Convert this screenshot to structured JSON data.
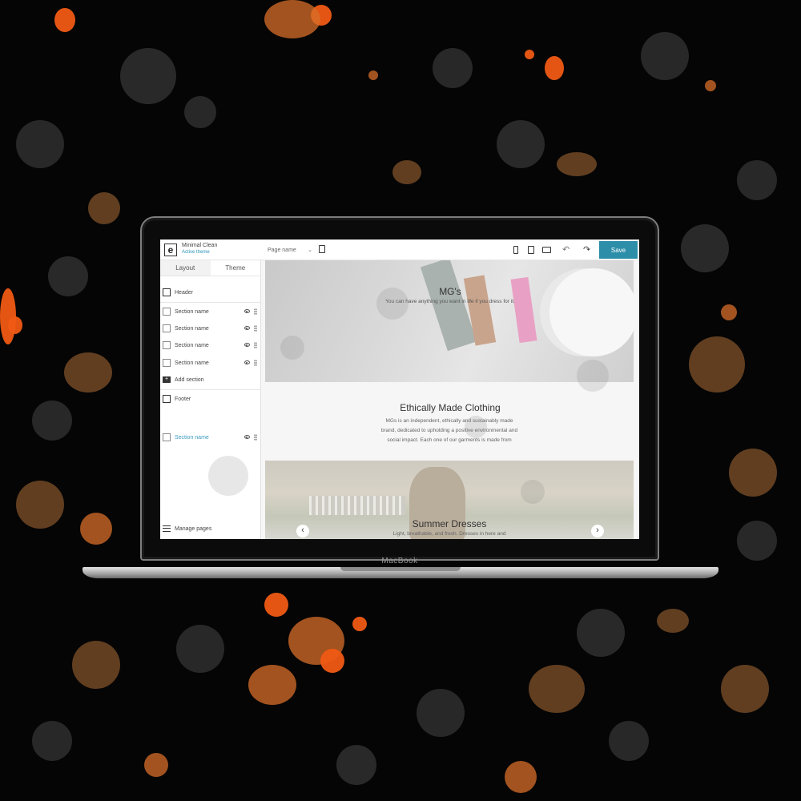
{
  "colors": {
    "accent": "#2d8ea9",
    "active_theme_text": "#2b94b8",
    "selected_section_text": "#3c9ac0",
    "background": "#050505",
    "splatter_orange": "#f05a14"
  },
  "device": {
    "brand_label": "MacBook"
  },
  "topbar": {
    "theme_name": "Minimal Clean",
    "theme_status": "Active theme",
    "page_select_value": "Page name",
    "save_label": "Save",
    "icons": [
      "document-icon",
      "mobile-icon",
      "tablet-icon",
      "desktop-icon",
      "undo-icon",
      "redo-icon"
    ]
  },
  "sidebar": {
    "tabs": [
      {
        "label": "Layout",
        "active": true
      },
      {
        "label": "Theme",
        "active": false
      }
    ],
    "header_label": "Header",
    "sections": [
      {
        "label": "Section name"
      },
      {
        "label": "Section name"
      },
      {
        "label": "Section name"
      },
      {
        "label": "Section name"
      }
    ],
    "add_section_label": "Add section",
    "footer_label": "Footer",
    "extra_section_label": "Section name",
    "manage_pages_label": "Manage pages"
  },
  "preview": {
    "hero": {
      "title": "MG's",
      "subtitle": "You can have anything you want in life if you dress for it."
    },
    "about": {
      "title": "Ethically Made Clothing",
      "text_lines": [
        "MGs is an independent, ethically and sustainably made",
        "brand, dedicated to upholding a positive environmental and",
        "social impact. Each one of our garments is made from"
      ]
    },
    "banner": {
      "title": "Summer Dresses",
      "subtitle": "Light, breathable, and fresh. Dresses in here and"
    }
  }
}
